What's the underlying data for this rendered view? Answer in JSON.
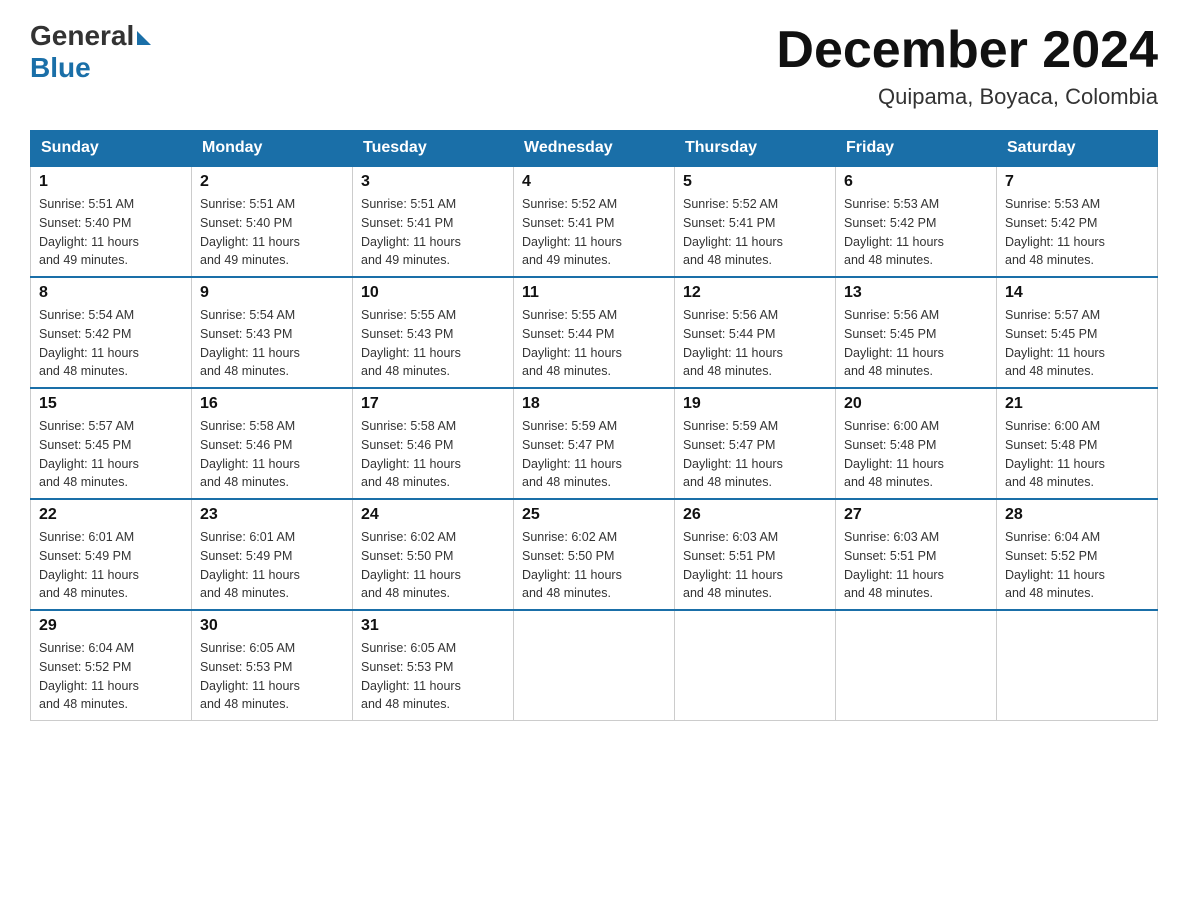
{
  "logo": {
    "general": "General",
    "blue": "Blue"
  },
  "title": "December 2024",
  "subtitle": "Quipama, Boyaca, Colombia",
  "days_header": [
    "Sunday",
    "Monday",
    "Tuesday",
    "Wednesday",
    "Thursday",
    "Friday",
    "Saturday"
  ],
  "weeks": [
    [
      {
        "day": "1",
        "sunrise": "5:51 AM",
        "sunset": "5:40 PM",
        "daylight": "11 hours and 49 minutes."
      },
      {
        "day": "2",
        "sunrise": "5:51 AM",
        "sunset": "5:40 PM",
        "daylight": "11 hours and 49 minutes."
      },
      {
        "day": "3",
        "sunrise": "5:51 AM",
        "sunset": "5:41 PM",
        "daylight": "11 hours and 49 minutes."
      },
      {
        "day": "4",
        "sunrise": "5:52 AM",
        "sunset": "5:41 PM",
        "daylight": "11 hours and 49 minutes."
      },
      {
        "day": "5",
        "sunrise": "5:52 AM",
        "sunset": "5:41 PM",
        "daylight": "11 hours and 48 minutes."
      },
      {
        "day": "6",
        "sunrise": "5:53 AM",
        "sunset": "5:42 PM",
        "daylight": "11 hours and 48 minutes."
      },
      {
        "day": "7",
        "sunrise": "5:53 AM",
        "sunset": "5:42 PM",
        "daylight": "11 hours and 48 minutes."
      }
    ],
    [
      {
        "day": "8",
        "sunrise": "5:54 AM",
        "sunset": "5:42 PM",
        "daylight": "11 hours and 48 minutes."
      },
      {
        "day": "9",
        "sunrise": "5:54 AM",
        "sunset": "5:43 PM",
        "daylight": "11 hours and 48 minutes."
      },
      {
        "day": "10",
        "sunrise": "5:55 AM",
        "sunset": "5:43 PM",
        "daylight": "11 hours and 48 minutes."
      },
      {
        "day": "11",
        "sunrise": "5:55 AM",
        "sunset": "5:44 PM",
        "daylight": "11 hours and 48 minutes."
      },
      {
        "day": "12",
        "sunrise": "5:56 AM",
        "sunset": "5:44 PM",
        "daylight": "11 hours and 48 minutes."
      },
      {
        "day": "13",
        "sunrise": "5:56 AM",
        "sunset": "5:45 PM",
        "daylight": "11 hours and 48 minutes."
      },
      {
        "day": "14",
        "sunrise": "5:57 AM",
        "sunset": "5:45 PM",
        "daylight": "11 hours and 48 minutes."
      }
    ],
    [
      {
        "day": "15",
        "sunrise": "5:57 AM",
        "sunset": "5:45 PM",
        "daylight": "11 hours and 48 minutes."
      },
      {
        "day": "16",
        "sunrise": "5:58 AM",
        "sunset": "5:46 PM",
        "daylight": "11 hours and 48 minutes."
      },
      {
        "day": "17",
        "sunrise": "5:58 AM",
        "sunset": "5:46 PM",
        "daylight": "11 hours and 48 minutes."
      },
      {
        "day": "18",
        "sunrise": "5:59 AM",
        "sunset": "5:47 PM",
        "daylight": "11 hours and 48 minutes."
      },
      {
        "day": "19",
        "sunrise": "5:59 AM",
        "sunset": "5:47 PM",
        "daylight": "11 hours and 48 minutes."
      },
      {
        "day": "20",
        "sunrise": "6:00 AM",
        "sunset": "5:48 PM",
        "daylight": "11 hours and 48 minutes."
      },
      {
        "day": "21",
        "sunrise": "6:00 AM",
        "sunset": "5:48 PM",
        "daylight": "11 hours and 48 minutes."
      }
    ],
    [
      {
        "day": "22",
        "sunrise": "6:01 AM",
        "sunset": "5:49 PM",
        "daylight": "11 hours and 48 minutes."
      },
      {
        "day": "23",
        "sunrise": "6:01 AM",
        "sunset": "5:49 PM",
        "daylight": "11 hours and 48 minutes."
      },
      {
        "day": "24",
        "sunrise": "6:02 AM",
        "sunset": "5:50 PM",
        "daylight": "11 hours and 48 minutes."
      },
      {
        "day": "25",
        "sunrise": "6:02 AM",
        "sunset": "5:50 PM",
        "daylight": "11 hours and 48 minutes."
      },
      {
        "day": "26",
        "sunrise": "6:03 AM",
        "sunset": "5:51 PM",
        "daylight": "11 hours and 48 minutes."
      },
      {
        "day": "27",
        "sunrise": "6:03 AM",
        "sunset": "5:51 PM",
        "daylight": "11 hours and 48 minutes."
      },
      {
        "day": "28",
        "sunrise": "6:04 AM",
        "sunset": "5:52 PM",
        "daylight": "11 hours and 48 minutes."
      }
    ],
    [
      {
        "day": "29",
        "sunrise": "6:04 AM",
        "sunset": "5:52 PM",
        "daylight": "11 hours and 48 minutes."
      },
      {
        "day": "30",
        "sunrise": "6:05 AM",
        "sunset": "5:53 PM",
        "daylight": "11 hours and 48 minutes."
      },
      {
        "day": "31",
        "sunrise": "6:05 AM",
        "sunset": "5:53 PM",
        "daylight": "11 hours and 48 minutes."
      },
      null,
      null,
      null,
      null
    ]
  ],
  "labels": {
    "sunrise": "Sunrise:",
    "sunset": "Sunset:",
    "daylight": "Daylight:"
  }
}
